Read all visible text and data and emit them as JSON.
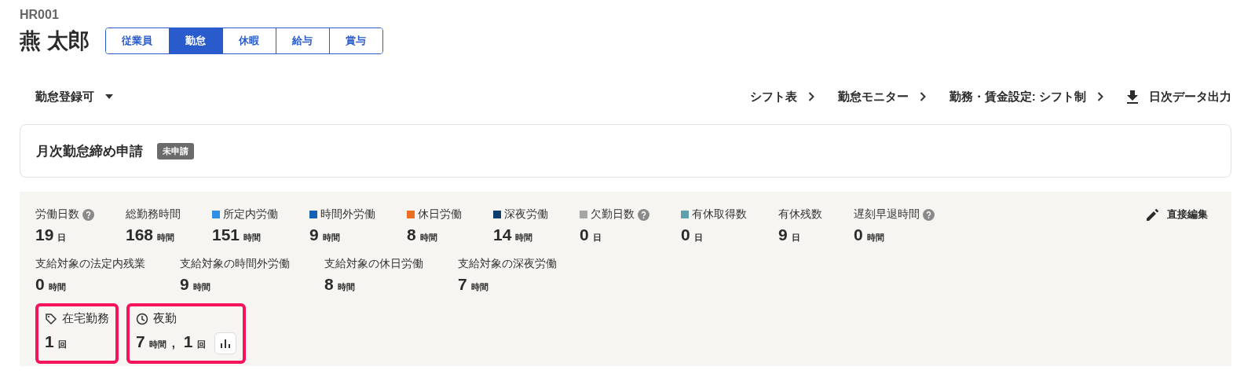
{
  "employee_code": "HR001",
  "employee_name": "燕 太郎",
  "tabs": [
    {
      "label": "従業員",
      "selected": false
    },
    {
      "label": "勤怠",
      "selected": true
    },
    {
      "label": "休暇",
      "selected": false
    },
    {
      "label": "給与",
      "selected": false
    },
    {
      "label": "賞与",
      "selected": false
    }
  ],
  "toolbar": {
    "status_dropdown": "勤怠登録可",
    "links": [
      {
        "label": "シフト表",
        "kind": "link"
      },
      {
        "label": "勤怠モニター",
        "kind": "link"
      },
      {
        "label": "勤務・賃金設定: シフト制",
        "kind": "link"
      },
      {
        "label": "日次データ出力",
        "kind": "download"
      }
    ]
  },
  "closing_request": {
    "title": "月次勤怠締め申請",
    "status": "未申請"
  },
  "stats": {
    "edit_button": "直接編集",
    "summary": [
      {
        "label": "労働日数",
        "help": true,
        "value": "19",
        "unit": "日"
      },
      {
        "label": "総勤務時間",
        "help": false,
        "value": "168",
        "unit": "時間"
      },
      {
        "label": "所定内労働",
        "help": false,
        "color": "#2f8fe8",
        "value": "151",
        "unit": "時間"
      },
      {
        "label": "時間外労働",
        "help": false,
        "color": "#1361b5",
        "value": "9",
        "unit": "時間"
      },
      {
        "label": "休日労働",
        "help": false,
        "color": "#ec6e23",
        "value": "8",
        "unit": "時間"
      },
      {
        "label": "深夜労働",
        "help": false,
        "color": "#0d3d6b",
        "value": "14",
        "unit": "時間"
      },
      {
        "label": "欠勤日数",
        "help": true,
        "color": "#a5a5a5",
        "value": "0",
        "unit": "日"
      },
      {
        "label": "有休取得数",
        "help": false,
        "color": "#5f9fae",
        "value": "0",
        "unit": "日"
      },
      {
        "label": "有休残数",
        "help": false,
        "value": "9",
        "unit": "日"
      },
      {
        "label": "遅刻早退時間",
        "help": true,
        "value": "0",
        "unit": "時間"
      }
    ],
    "payable": [
      {
        "label": "支給対象の法定内残業",
        "help": false,
        "value": "0",
        "unit": "時間"
      },
      {
        "label": "支給対象の時間外労働",
        "help": false,
        "value": "9",
        "unit": "時間"
      },
      {
        "label": "支給対象の休日労働",
        "help": false,
        "value": "8",
        "unit": "時間"
      },
      {
        "label": "支給対象の深夜労働",
        "help": false,
        "value": "7",
        "unit": "時間"
      }
    ]
  },
  "custom_items": [
    {
      "kind": "tag",
      "label": "在宅勤務",
      "highlighted": true,
      "chart_button": false,
      "values": [
        {
          "value": "1",
          "unit": "回"
        }
      ]
    },
    {
      "kind": "clock",
      "label": "夜勤",
      "highlighted": true,
      "chart_button": true,
      "separator": ",",
      "values": [
        {
          "value": "7",
          "unit": "時間"
        },
        {
          "value": "1",
          "unit": "回"
        }
      ]
    }
  ]
}
